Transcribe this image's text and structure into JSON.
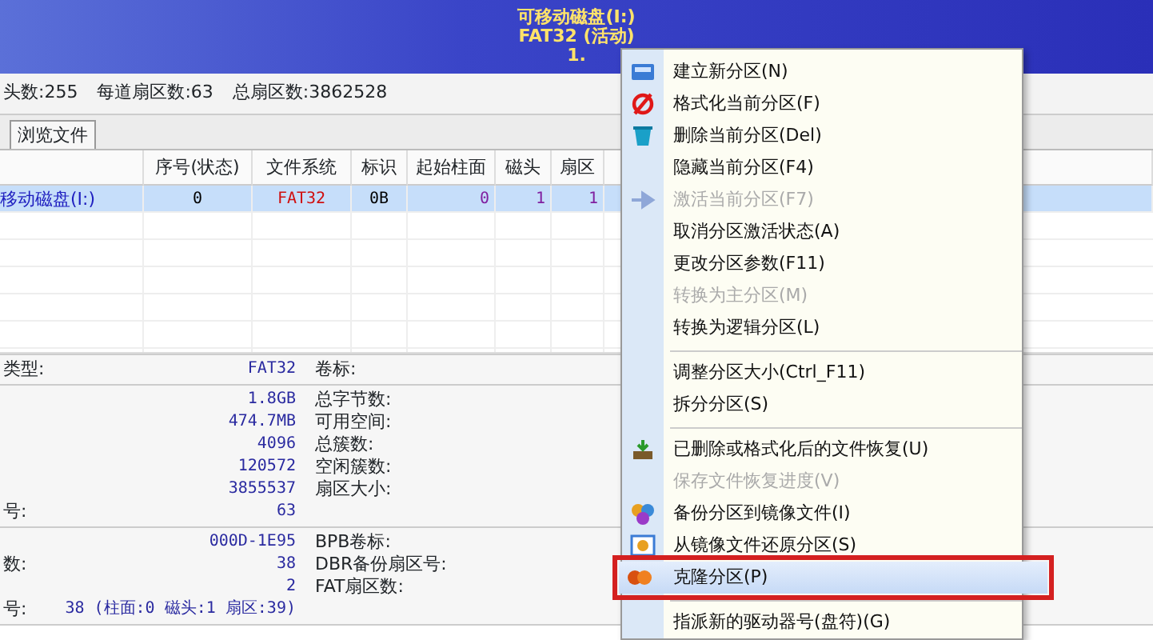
{
  "banner": {
    "lines": [
      "可移动磁盘(I:)",
      "FAT32 (活动)",
      "1."
    ]
  },
  "disk_info": [
    "头数:255",
    "每道扇区数:63",
    "总扇区数:3862528"
  ],
  "tabs": [
    {
      "label": "浏览文件"
    }
  ],
  "table": {
    "columns": [
      "序号(状态)",
      "文件系统",
      "标识",
      "起始柱面",
      "磁头",
      "扇区"
    ],
    "rows": [
      {
        "name": "移动磁盘(I:)",
        "cells": [
          "0",
          "FAT32",
          "0B",
          "0",
          "1",
          "1"
        ],
        "selected": true
      }
    ]
  },
  "details": [
    [
      {
        "label": "类型:",
        "value": "FAT32",
        "field": "卷标:"
      }
    ],
    [
      {
        "value": "1.8GB",
        "field": "总字节数:"
      },
      {
        "value": "474.7MB",
        "field": "可用空间:"
      },
      {
        "value": "4096",
        "field": "总簇数:"
      },
      {
        "value": "120572",
        "field": "空闲簇数:"
      },
      {
        "value": "3855537",
        "field": "扇区大小:"
      },
      {
        "label": "号:",
        "value": "63"
      }
    ],
    [
      {
        "value": "000D-1E95",
        "field": "BPB卷标:"
      },
      {
        "label": "数:",
        "value": "38",
        "field": "DBR备份扇区号:"
      },
      {
        "value": "2",
        "field": "FAT扇区数:"
      },
      {
        "label": "号:",
        "value": "38 (柱面:0 磁头:1 扇区:39)"
      }
    ]
  ],
  "context_menu": [
    {
      "kind": "item",
      "label": "建立新分区(N)",
      "disabled": false,
      "selected": false
    },
    {
      "kind": "item",
      "label": "格式化当前分区(F)",
      "disabled": false,
      "selected": false
    },
    {
      "kind": "item",
      "label": "删除当前分区(Del)",
      "disabled": false,
      "selected": false
    },
    {
      "kind": "item",
      "label": "隐藏当前分区(F4)",
      "disabled": false,
      "selected": false
    },
    {
      "kind": "item",
      "label": "激活当前分区(F7)",
      "disabled": true,
      "selected": false
    },
    {
      "kind": "item",
      "label": "取消分区激活状态(A)",
      "disabled": false,
      "selected": false
    },
    {
      "kind": "item",
      "label": "更改分区参数(F11)",
      "disabled": false,
      "selected": false
    },
    {
      "kind": "item",
      "label": "转换为主分区(M)",
      "disabled": true,
      "selected": false
    },
    {
      "kind": "item",
      "label": "转换为逻辑分区(L)",
      "disabled": false,
      "selected": false
    },
    {
      "kind": "separator"
    },
    {
      "kind": "item",
      "label": "调整分区大小(Ctrl_F11)",
      "disabled": false,
      "selected": false
    },
    {
      "kind": "item",
      "label": "拆分分区(S)",
      "disabled": false,
      "selected": false
    },
    {
      "kind": "separator"
    },
    {
      "kind": "item",
      "label": "已删除或格式化后的文件恢复(U)",
      "disabled": false,
      "selected": false
    },
    {
      "kind": "item",
      "label": "保存文件恢复进度(V)",
      "disabled": true,
      "selected": false
    },
    {
      "kind": "item",
      "label": "备份分区到镜像文件(I)",
      "disabled": false,
      "selected": false
    },
    {
      "kind": "item",
      "label": "从镜像文件还原分区(S)",
      "disabled": false,
      "selected": false
    },
    {
      "kind": "item",
      "label": "克隆分区(P)",
      "disabled": false,
      "selected": true
    },
    {
      "kind": "separator"
    },
    {
      "kind": "item",
      "label": "指派新的驱动器号(盘符)(G)",
      "disabled": false,
      "selected": false
    }
  ]
}
